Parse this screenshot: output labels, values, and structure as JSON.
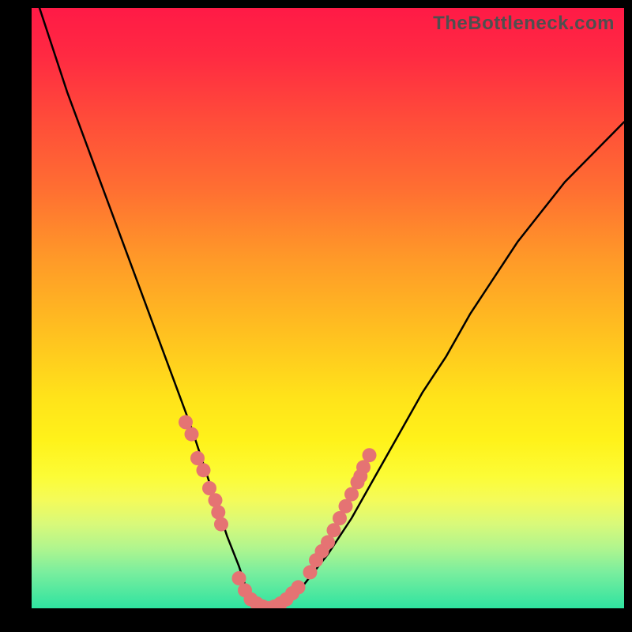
{
  "watermark": "TheBottleneck.com",
  "colors": {
    "page_bg": "#000000",
    "watermark": "#4f4f4f",
    "curve": "#000000",
    "scatter": "#e57373"
  },
  "chart_data": {
    "type": "line",
    "title": "",
    "xlabel": "",
    "ylabel": "",
    "xlim": [
      0,
      100
    ],
    "ylim": [
      0,
      100
    ],
    "grid": false,
    "series": [
      {
        "name": "bottleneck-curve",
        "x": [
          0,
          3,
          6,
          9,
          12,
          15,
          18,
          21,
          24,
          27,
          29,
          31,
          33,
          35,
          36,
          38,
          40,
          43,
          46,
          50,
          54,
          58,
          62,
          66,
          70,
          74,
          78,
          82,
          86,
          90,
          94,
          98,
          100
        ],
        "y": [
          104,
          95,
          86,
          78,
          70,
          62,
          54,
          46,
          38,
          30,
          24,
          18,
          12,
          7,
          4,
          1,
          0,
          1,
          4,
          9,
          15,
          22,
          29,
          36,
          42,
          49,
          55,
          61,
          66,
          71,
          75,
          79,
          81
        ]
      }
    ],
    "scatter": [
      {
        "name": "highlight-points",
        "points": [
          {
            "x": 26,
            "y": 31
          },
          {
            "x": 27,
            "y": 29
          },
          {
            "x": 28,
            "y": 25
          },
          {
            "x": 29,
            "y": 23
          },
          {
            "x": 30,
            "y": 20
          },
          {
            "x": 31,
            "y": 18
          },
          {
            "x": 31.5,
            "y": 16
          },
          {
            "x": 32,
            "y": 14
          },
          {
            "x": 35,
            "y": 5
          },
          {
            "x": 36,
            "y": 3
          },
          {
            "x": 37,
            "y": 1.5
          },
          {
            "x": 38,
            "y": 0.8
          },
          {
            "x": 39,
            "y": 0.3
          },
          {
            "x": 40,
            "y": 0
          },
          {
            "x": 41,
            "y": 0.3
          },
          {
            "x": 42,
            "y": 0.8
          },
          {
            "x": 43,
            "y": 1.5
          },
          {
            "x": 44,
            "y": 2.5
          },
          {
            "x": 45,
            "y": 3.5
          },
          {
            "x": 47,
            "y": 6
          },
          {
            "x": 48,
            "y": 8
          },
          {
            "x": 49,
            "y": 9.5
          },
          {
            "x": 50,
            "y": 11
          },
          {
            "x": 51,
            "y": 13
          },
          {
            "x": 52,
            "y": 15
          },
          {
            "x": 53,
            "y": 17
          },
          {
            "x": 54,
            "y": 19
          },
          {
            "x": 55,
            "y": 21
          },
          {
            "x": 55.5,
            "y": 22
          },
          {
            "x": 56,
            "y": 23.5
          },
          {
            "x": 57,
            "y": 25.5
          }
        ]
      }
    ]
  }
}
